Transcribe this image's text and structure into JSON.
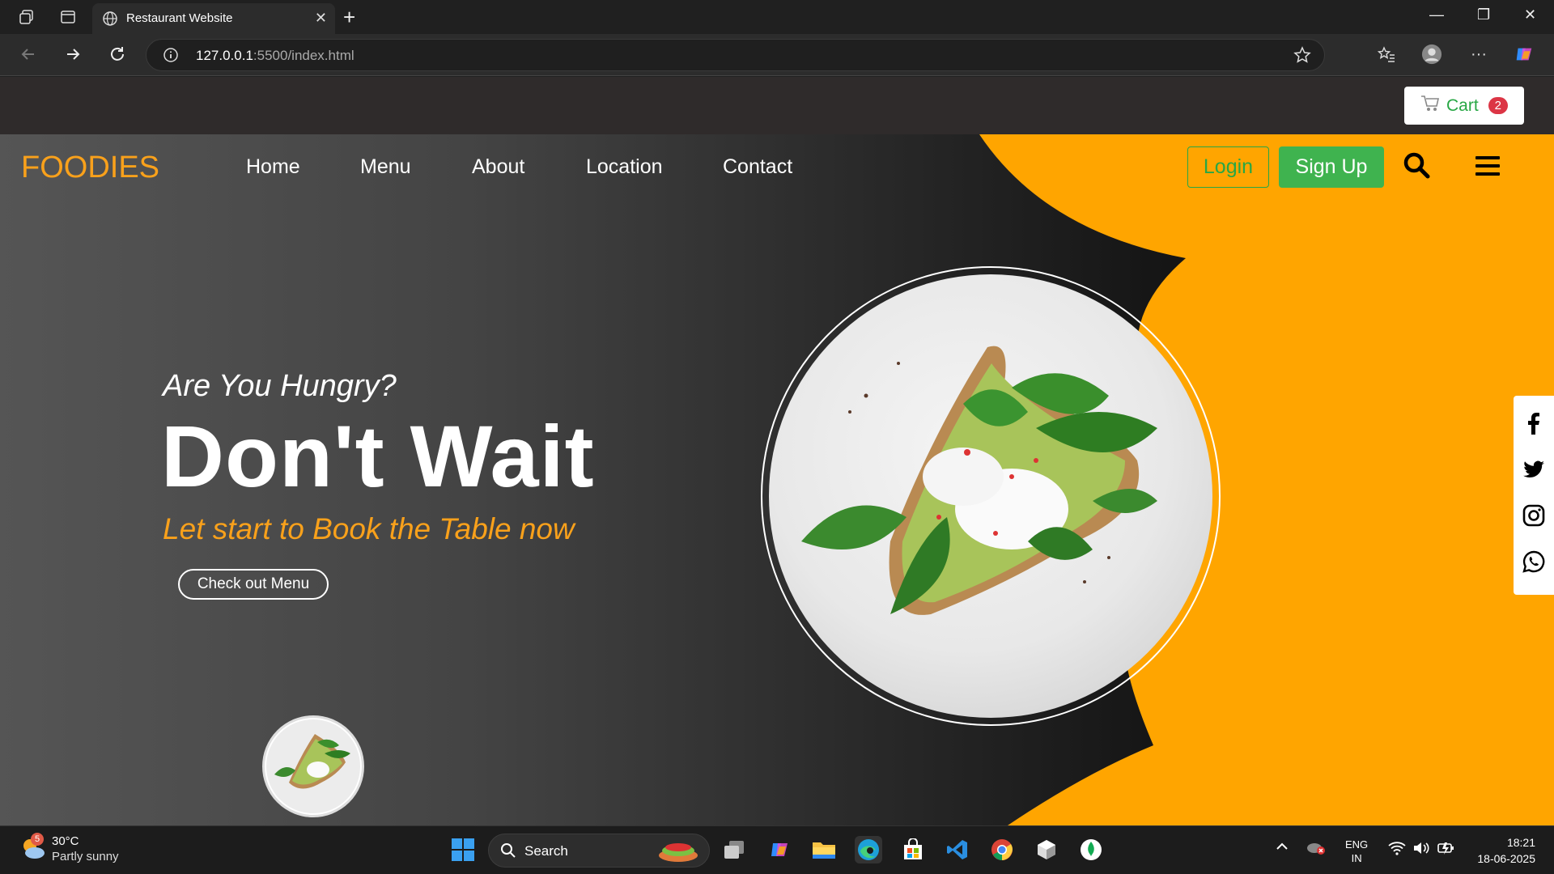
{
  "browser": {
    "tab_title": "Restaurant Website",
    "url_host": "127.0.0.1",
    "url_rest": ":5500/index.html"
  },
  "site": {
    "cart_label": "Cart",
    "cart_count": "2",
    "logo": "FOODIES",
    "nav": [
      "Home",
      "Menu",
      "About",
      "Location",
      "Contact"
    ],
    "login": "Login",
    "signup": "Sign Up",
    "hero_sub": "Are You Hungry?",
    "hero_title": "Don't Wait",
    "hero_tag": "Let start to Book the Table now",
    "cta": "Check out Menu",
    "social": [
      "facebook-icon",
      "twitter-icon",
      "instagram-icon",
      "whatsapp-icon"
    ]
  },
  "taskbar": {
    "weather_badge": "5",
    "temp": "30°C",
    "condition": "Partly sunny",
    "search": "Search",
    "lang1": "ENG",
    "lang2": "IN",
    "time": "18:21",
    "date": "18-06-2025"
  },
  "colors": {
    "accent_orange": "#FFA500",
    "brand_orange": "#F9A11B",
    "green": "#28A745",
    "badge_red": "#DC3545"
  }
}
